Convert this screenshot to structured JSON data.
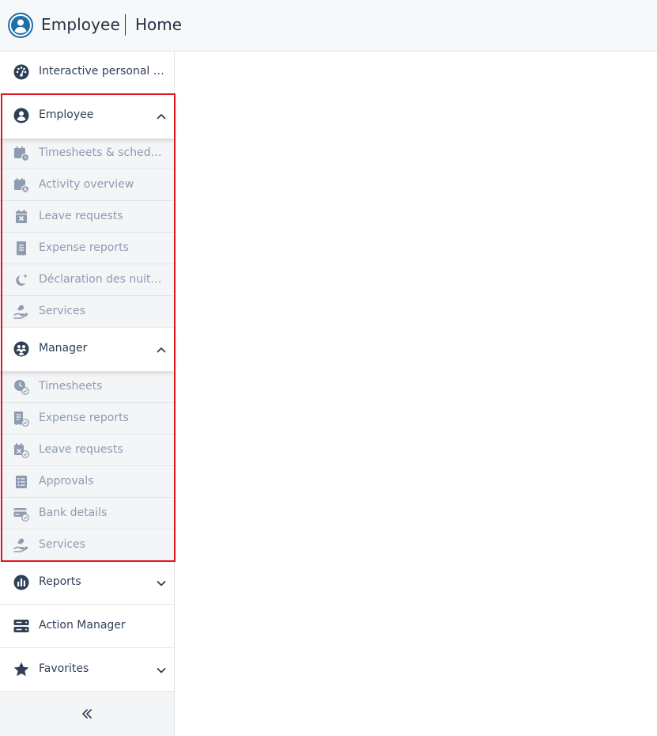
{
  "header": {
    "app_title": "Employee",
    "page_title": "Home",
    "logo_icon": "user-circle-icon"
  },
  "sidebar": {
    "dashboard": {
      "label": "Interactive personal da...",
      "icon": "dashboard-gauge-icon"
    },
    "employee_group": {
      "label": "Employee",
      "icon": "user-circle-icon",
      "expanded": true,
      "items": [
        {
          "label": "Timesheets & schedules",
          "icon": "calendar-clock-icon"
        },
        {
          "label": "Activity overview",
          "icon": "calendar-user-icon"
        },
        {
          "label": "Leave requests",
          "icon": "calendar-x-icon"
        },
        {
          "label": "Expense reports",
          "icon": "receipt-icon"
        },
        {
          "label": "Déclaration des nuitées...",
          "icon": "moon-star-icon"
        },
        {
          "label": "Services",
          "icon": "hand-service-icon"
        }
      ]
    },
    "manager_group": {
      "label": "Manager",
      "icon": "users-circle-icon",
      "expanded": true,
      "items": [
        {
          "label": "Timesheets",
          "icon": "clock-check-icon"
        },
        {
          "label": "Expense reports",
          "icon": "receipt-check-icon"
        },
        {
          "label": "Leave requests",
          "icon": "calendar-x-check-icon"
        },
        {
          "label": "Approvals",
          "icon": "checklist-icon"
        },
        {
          "label": "Bank details",
          "icon": "credit-card-check-icon"
        },
        {
          "label": "Services",
          "icon": "hand-service-icon"
        }
      ]
    },
    "reports": {
      "label": "Reports",
      "icon": "chart-circle-icon"
    },
    "action_manager": {
      "label": "Action Manager",
      "icon": "server-icon"
    },
    "favorites": {
      "label": "Favorites",
      "icon": "star-icon"
    },
    "collapse_icon": "double-chevron-left-icon"
  },
  "colors": {
    "highlight_border": "#e0161e",
    "text_primary": "#2f3f55",
    "text_secondary": "#8e9bb0",
    "submenu_bg": "#f4f5f7"
  }
}
